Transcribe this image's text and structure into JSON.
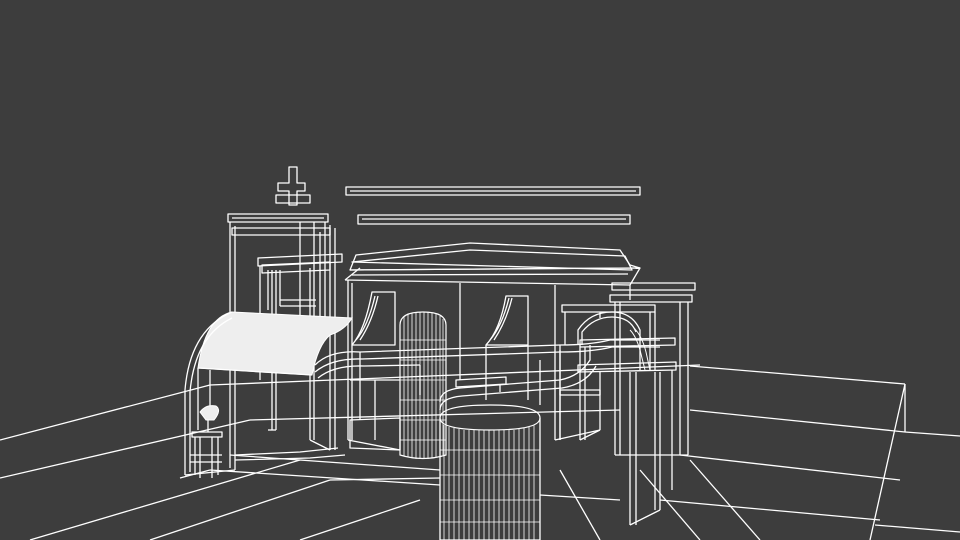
{
  "viewport": {
    "background_color": "#3d3d3d",
    "wire_color": "#ffffff",
    "render_mode": "wireframe"
  }
}
